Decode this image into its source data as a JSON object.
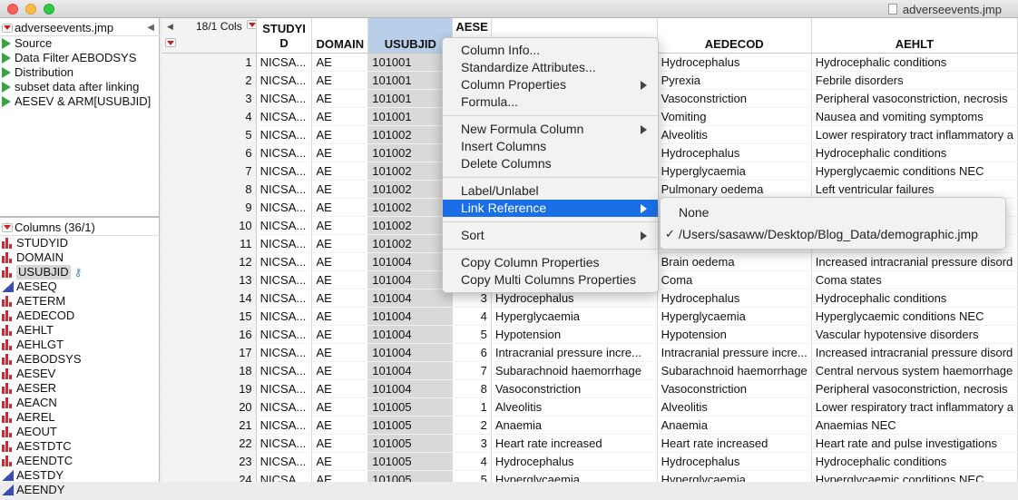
{
  "window": {
    "title": "adverseevents.jmp"
  },
  "table_panel": {
    "table_name": "adverseevents.jmp",
    "scripts": [
      "Source",
      "Data Filter AEBODSYS",
      "Distribution",
      "subset data after linking",
      "AESEV & ARM[USUBJID]"
    ]
  },
  "columns_panel": {
    "header": "Columns (36/1)",
    "columns": [
      {
        "name": "STUDYID",
        "icon": "nominal-bars-icon"
      },
      {
        "name": "DOMAIN",
        "icon": "nominal-bars-icon"
      },
      {
        "name": "USUBJID",
        "icon": "nominal-bars-icon",
        "selected": true,
        "link_icon": "key-icon"
      },
      {
        "name": "AESEQ",
        "icon": "continuous-triangle-icon"
      },
      {
        "name": "AETERM",
        "icon": "nominal-bars-icon"
      },
      {
        "name": "AEDECOD",
        "icon": "nominal-bars-icon"
      },
      {
        "name": "AEHLT",
        "icon": "nominal-bars-icon"
      },
      {
        "name": "AEHLGT",
        "icon": "nominal-bars-icon"
      },
      {
        "name": "AEBODSYS",
        "icon": "nominal-bars-icon"
      },
      {
        "name": "AESEV",
        "icon": "nominal-bars-icon"
      },
      {
        "name": "AESER",
        "icon": "nominal-bars-icon"
      },
      {
        "name": "AEACN",
        "icon": "nominal-bars-icon"
      },
      {
        "name": "AEREL",
        "icon": "nominal-bars-icon"
      },
      {
        "name": "AEOUT",
        "icon": "nominal-bars-icon"
      },
      {
        "name": "AESTDTC",
        "icon": "nominal-bars-icon"
      },
      {
        "name": "AEENDTC",
        "icon": "nominal-bars-icon"
      },
      {
        "name": "AESTDY",
        "icon": "continuous-triangle-icon"
      },
      {
        "name": "AEENDY",
        "icon": "continuous-triangle-icon"
      }
    ]
  },
  "grid": {
    "cols_count_label": "18/1 Cols",
    "headers": {
      "studyid": "STUDYID",
      "domain": "DOMAIN",
      "usubjid": "USUBJID",
      "aeseq": "AESE",
      "aedecod": "AEDECOD",
      "aehlt": "AEHLT"
    },
    "rows": [
      {
        "n": "1",
        "studyid": "NICSA...",
        "domain": "AE",
        "usubjid": "101001",
        "aeseq": "",
        "aeterm": "",
        "aedecod": "Hydrocephalus",
        "aehlt": "Hydrocephalic conditions"
      },
      {
        "n": "2",
        "studyid": "NICSA...",
        "domain": "AE",
        "usubjid": "101001",
        "aeseq": "",
        "aeterm": "",
        "aedecod": "Pyrexia",
        "aehlt": "Febrile disorders"
      },
      {
        "n": "3",
        "studyid": "NICSA...",
        "domain": "AE",
        "usubjid": "101001",
        "aeseq": "",
        "aeterm": "",
        "aedecod": "Vasoconstriction",
        "aehlt": "Peripheral vasoconstriction, necrosis"
      },
      {
        "n": "4",
        "studyid": "NICSA...",
        "domain": "AE",
        "usubjid": "101001",
        "aeseq": "",
        "aeterm": "",
        "aedecod": "Vomiting",
        "aehlt": "Nausea and vomiting symptoms"
      },
      {
        "n": "5",
        "studyid": "NICSA...",
        "domain": "AE",
        "usubjid": "101002",
        "aeseq": "",
        "aeterm": "",
        "aedecod": "Alveolitis",
        "aehlt": "Lower respiratory tract inflammatory a"
      },
      {
        "n": "6",
        "studyid": "NICSA...",
        "domain": "AE",
        "usubjid": "101002",
        "aeseq": "",
        "aeterm": "",
        "aedecod": "Hydrocephalus",
        "aehlt": "Hydrocephalic conditions"
      },
      {
        "n": "7",
        "studyid": "NICSA...",
        "domain": "AE",
        "usubjid": "101002",
        "aeseq": "",
        "aeterm": "",
        "aedecod": "Hyperglycaemia",
        "aehlt": "Hyperglycaemic conditions NEC"
      },
      {
        "n": "8",
        "studyid": "NICSA...",
        "domain": "AE",
        "usubjid": "101002",
        "aeseq": "",
        "aeterm": "",
        "aedecod": "Pulmonary oedema",
        "aehlt": "Left ventricular failures"
      },
      {
        "n": "9",
        "studyid": "NICSA...",
        "domain": "AE",
        "usubjid": "101002",
        "aeseq": "",
        "aeterm": "",
        "aedecod": "",
        "aehlt": "nfla"
      },
      {
        "n": "10",
        "studyid": "NICSA...",
        "domain": "AE",
        "usubjid": "101002",
        "aeseq": "",
        "aeterm": "",
        "aedecod": "",
        "aehlt": ""
      },
      {
        "n": "11",
        "studyid": "NICSA...",
        "domain": "AE",
        "usubjid": "101002",
        "aeseq": "",
        "aeterm": "",
        "aedecod": "",
        "aehlt": ""
      },
      {
        "n": "12",
        "studyid": "NICSA...",
        "domain": "AE",
        "usubjid": "101004",
        "aeseq": "",
        "aeterm": "",
        "aedecod": "Brain oedema",
        "aehlt": "Increased intracranial pressure disord"
      },
      {
        "n": "13",
        "studyid": "NICSA...",
        "domain": "AE",
        "usubjid": "101004",
        "aeseq": "",
        "aeterm": "",
        "aedecod": "Coma",
        "aehlt": "Coma states"
      },
      {
        "n": "14",
        "studyid": "NICSA...",
        "domain": "AE",
        "usubjid": "101004",
        "aeseq": "3",
        "aeterm": "Hydrocephalus",
        "aedecod": "Hydrocephalus",
        "aehlt": "Hydrocephalic conditions"
      },
      {
        "n": "15",
        "studyid": "NICSA...",
        "domain": "AE",
        "usubjid": "101004",
        "aeseq": "4",
        "aeterm": "Hyperglycaemia",
        "aedecod": "Hyperglycaemia",
        "aehlt": "Hyperglycaemic conditions NEC"
      },
      {
        "n": "16",
        "studyid": "NICSA...",
        "domain": "AE",
        "usubjid": "101004",
        "aeseq": "5",
        "aeterm": "Hypotension",
        "aedecod": "Hypotension",
        "aehlt": "Vascular hypotensive disorders"
      },
      {
        "n": "17",
        "studyid": "NICSA...",
        "domain": "AE",
        "usubjid": "101004",
        "aeseq": "6",
        "aeterm": "Intracranial pressure incre...",
        "aedecod": "Intracranial pressure incre...",
        "aehlt": "Increased intracranial pressure disord"
      },
      {
        "n": "18",
        "studyid": "NICSA...",
        "domain": "AE",
        "usubjid": "101004",
        "aeseq": "7",
        "aeterm": "Subarachnoid haemorrhage",
        "aedecod": "Subarachnoid haemorrhage",
        "aehlt": "Central nervous system haemorrhage"
      },
      {
        "n": "19",
        "studyid": "NICSA...",
        "domain": "AE",
        "usubjid": "101004",
        "aeseq": "8",
        "aeterm": "Vasoconstriction",
        "aedecod": "Vasoconstriction",
        "aehlt": "Peripheral vasoconstriction, necrosis"
      },
      {
        "n": "20",
        "studyid": "NICSA...",
        "domain": "AE",
        "usubjid": "101005",
        "aeseq": "1",
        "aeterm": "Alveolitis",
        "aedecod": "Alveolitis",
        "aehlt": "Lower respiratory tract inflammatory a"
      },
      {
        "n": "21",
        "studyid": "NICSA...",
        "domain": "AE",
        "usubjid": "101005",
        "aeseq": "2",
        "aeterm": "Anaemia",
        "aedecod": "Anaemia",
        "aehlt": "Anaemias NEC"
      },
      {
        "n": "22",
        "studyid": "NICSA...",
        "domain": "AE",
        "usubjid": "101005",
        "aeseq": "3",
        "aeterm": "Heart rate increased",
        "aedecod": "Heart rate increased",
        "aehlt": "Heart rate and pulse investigations"
      },
      {
        "n": "23",
        "studyid": "NICSA...",
        "domain": "AE",
        "usubjid": "101005",
        "aeseq": "4",
        "aeterm": "Hydrocephalus",
        "aedecod": "Hydrocephalus",
        "aehlt": "Hydrocephalic conditions"
      },
      {
        "n": "24",
        "studyid": "NICSA...",
        "domain": "AE",
        "usubjid": "101005",
        "aeseq": "5",
        "aeterm": "Hyperglycaemia",
        "aedecod": "Hyperglycaemia",
        "aehlt": "Hyperglycaemic conditions NEC"
      }
    ]
  },
  "context_menu": {
    "groups": [
      [
        {
          "label": "Column Info...",
          "submenu": false
        },
        {
          "label": "Standardize Attributes...",
          "submenu": false
        },
        {
          "label": "Column Properties",
          "submenu": true
        },
        {
          "label": "Formula...",
          "submenu": false
        }
      ],
      [
        {
          "label": "New Formula Column",
          "submenu": true
        },
        {
          "label": "Insert Columns",
          "submenu": false
        },
        {
          "label": "Delete Columns",
          "submenu": false
        }
      ],
      [
        {
          "label": "Label/Unlabel",
          "submenu": false
        },
        {
          "label": "Link Reference",
          "submenu": true,
          "active": true
        }
      ],
      [
        {
          "label": "Sort",
          "submenu": true
        }
      ],
      [
        {
          "label": "Copy Column Properties",
          "submenu": false
        },
        {
          "label": "Copy Multi Columns Properties",
          "submenu": false
        }
      ]
    ]
  },
  "submenu": {
    "items": [
      {
        "label": "None",
        "checked": false
      },
      {
        "label": "/Users/sasaww/Desktop/Blog_Data/demographic.jmp",
        "checked": true
      }
    ],
    "check_glyph": "✓"
  },
  "colors": {
    "menu_highlight": "#1a6fe6",
    "selected_column_header": "#b9cfe9",
    "nominal_icon": "#c0303a",
    "continuous_icon": "#3c4db0",
    "script_play": "#3aa442"
  }
}
